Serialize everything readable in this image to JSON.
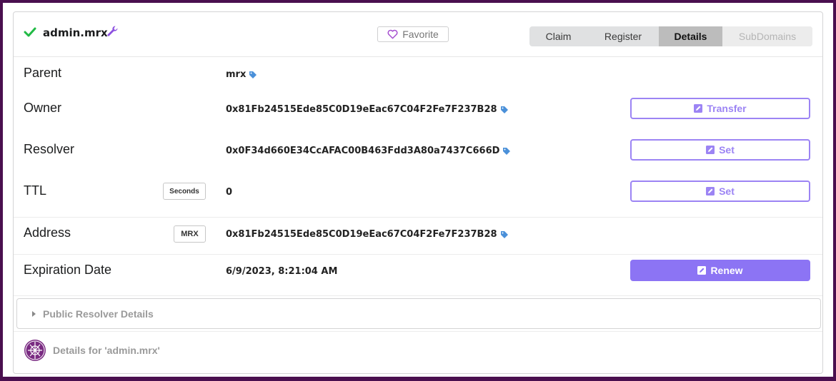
{
  "header": {
    "domain": "admin.mrx",
    "favorite_label": "Favorite",
    "tabs": [
      {
        "label": "Claim",
        "state": "inactive"
      },
      {
        "label": "Register",
        "state": "inactive"
      },
      {
        "label": "Details",
        "state": "active"
      },
      {
        "label": "SubDomains",
        "state": "disabled"
      }
    ]
  },
  "rows": {
    "parent": {
      "label": "Parent",
      "value": "mrx"
    },
    "owner": {
      "label": "Owner",
      "value": "0x81Fb24515Ede85C0D19eEac67C04F2Fe7F237B28",
      "button": "Transfer"
    },
    "resolver": {
      "label": "Resolver",
      "value": "0x0F34d660E34CcAFAC00B463Fdd3A80a7437C666D",
      "button": "Set"
    },
    "ttl": {
      "label": "TTL",
      "unit": "Seconds",
      "value": "0",
      "button": "Set"
    },
    "address": {
      "label": "Address",
      "coin": "MRX",
      "value": "0x81Fb24515Ede85C0D19eEac67C04F2Fe7F237B28"
    },
    "expiration": {
      "label": "Expiration Date",
      "value": "6/9/2023, 8:21:04 AM",
      "button": "Renew"
    }
  },
  "accordion": {
    "title": "Public Resolver Details"
  },
  "footer": {
    "text": "Details for 'admin.mrx'"
  },
  "colors": {
    "accent": "#8c74f4",
    "check": "#21ba45",
    "tag": "#4a90d9",
    "frame": "#4a0f4f"
  },
  "icons": [
    "check-icon",
    "wrench-icon",
    "heart-icon",
    "tag-icon",
    "edit-icon",
    "caret-right-icon",
    "logo-icon"
  ]
}
